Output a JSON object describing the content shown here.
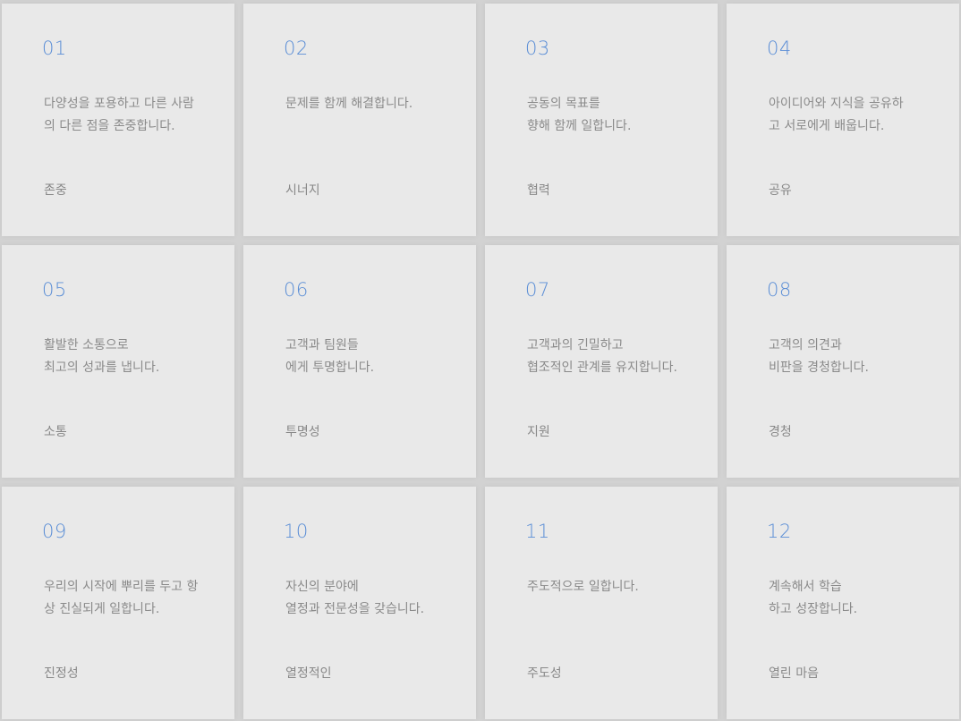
{
  "cards": [
    {
      "number": "01",
      "description": "다양성을 포용하고 다른 사람\n의 다른 점을 존중합니다.",
      "label": "존중"
    },
    {
      "number": "02",
      "description": "문제를 함께 해결합니다.",
      "label": "시너지"
    },
    {
      "number": "03",
      "description": "공동의 목표를\n향해 함께 일합니다.",
      "label": "협력"
    },
    {
      "number": "04",
      "description": "아이디어와 지식을 공유하\n고 서로에게 배웁니다.",
      "label": "공유"
    },
    {
      "number": "05",
      "description": "활발한 소통으로\n최고의 성과를 냅니다.",
      "label": "소통"
    },
    {
      "number": "06",
      "description": "고객과 팀원들\n에게 투명합니다.",
      "label": "투명성"
    },
    {
      "number": "07",
      "description": "고객과의 긴밀하고\n협조적인 관계를 유지합니다.",
      "label": "지원"
    },
    {
      "number": "08",
      "description": "고객의 의견과\n비판을 경청합니다.",
      "label": "경청"
    },
    {
      "number": "09",
      "description": "우리의 시작에 뿌리를 두고 항\n상 진실되게 일합니다.",
      "label": "진정성"
    },
    {
      "number": "10",
      "description": "자신의 분야에\n열정과 전문성을 갖습니다.",
      "label": "열정적인"
    },
    {
      "number": "11",
      "description": "주도적으로 일합니다.",
      "label": "주도성"
    },
    {
      "number": "12",
      "description": "계속해서 학습\n하고 성장합니다.",
      "label": "열린 마음"
    }
  ],
  "colors": {
    "accent": "#5b8ed6",
    "card_background": "#e9e9e9",
    "page_background": "#d2d2d2",
    "text": "#8a8a8a"
  }
}
